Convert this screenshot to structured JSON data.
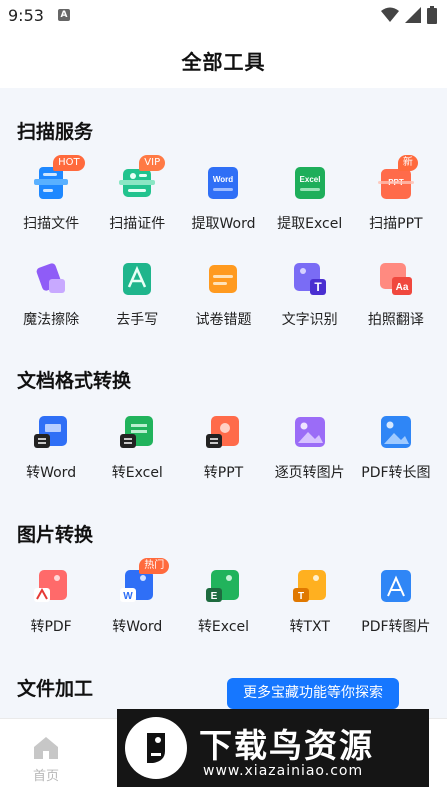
{
  "status": {
    "time": "9:53",
    "notif_glyph": "A"
  },
  "header": {
    "title": "全部工具"
  },
  "sections": [
    {
      "title": "扫描服务",
      "tools": [
        {
          "label": "扫描文件",
          "icon": "scan-file-icon",
          "badge": "HOT"
        },
        {
          "label": "扫描证件",
          "icon": "scan-id-icon",
          "badge": "VIP"
        },
        {
          "label": "提取Word",
          "icon": "extract-word-icon",
          "icon_text": "Word"
        },
        {
          "label": "提取Excel",
          "icon": "extract-excel-icon",
          "icon_text": "Excel"
        },
        {
          "label": "扫描PPT",
          "icon": "scan-ppt-icon",
          "badge": "新",
          "icon_text": "PPT"
        },
        {
          "label": "魔法擦除",
          "icon": "magic-erase-icon"
        },
        {
          "label": "去手写",
          "icon": "remove-handwriting-icon"
        },
        {
          "label": "试卷错题",
          "icon": "exam-mistakes-icon"
        },
        {
          "label": "文字识别",
          "icon": "text-recognition-icon",
          "icon_text": "T"
        },
        {
          "label": "拍照翻译",
          "icon": "photo-translate-icon",
          "icon_text": "Aa"
        }
      ]
    },
    {
      "title": "文档格式转换",
      "tools": [
        {
          "label": "转Word",
          "icon": "to-word-icon"
        },
        {
          "label": "转Excel",
          "icon": "to-excel-icon"
        },
        {
          "label": "转PPT",
          "icon": "to-ppt-icon"
        },
        {
          "label": "逐页转图片",
          "icon": "pages-to-image-icon"
        },
        {
          "label": "PDF转长图",
          "icon": "pdf-to-long-image-icon"
        }
      ]
    },
    {
      "title": "图片转换",
      "tools": [
        {
          "label": "转PDF",
          "icon": "image-to-pdf-icon"
        },
        {
          "label": "转Word",
          "icon": "image-to-word-icon",
          "badge": "热门",
          "icon_text": "W"
        },
        {
          "label": "转Excel",
          "icon": "image-to-excel-icon",
          "icon_text": "E"
        },
        {
          "label": "转TXT",
          "icon": "image-to-txt-icon",
          "icon_text": "T"
        },
        {
          "label": "PDF转图片",
          "icon": "pdf-to-image-icon"
        }
      ]
    },
    {
      "title": "文件加工",
      "tools": []
    }
  ],
  "more_button": {
    "label": "更多宝藏功能等你探索"
  },
  "tabbar": {
    "home_label": "首页"
  },
  "watermark": {
    "text": "下载鸟资源",
    "url": "www.xiazainiao.com"
  },
  "colors": {
    "accent": "#1677ff",
    "badge": "#ff6a3d"
  }
}
